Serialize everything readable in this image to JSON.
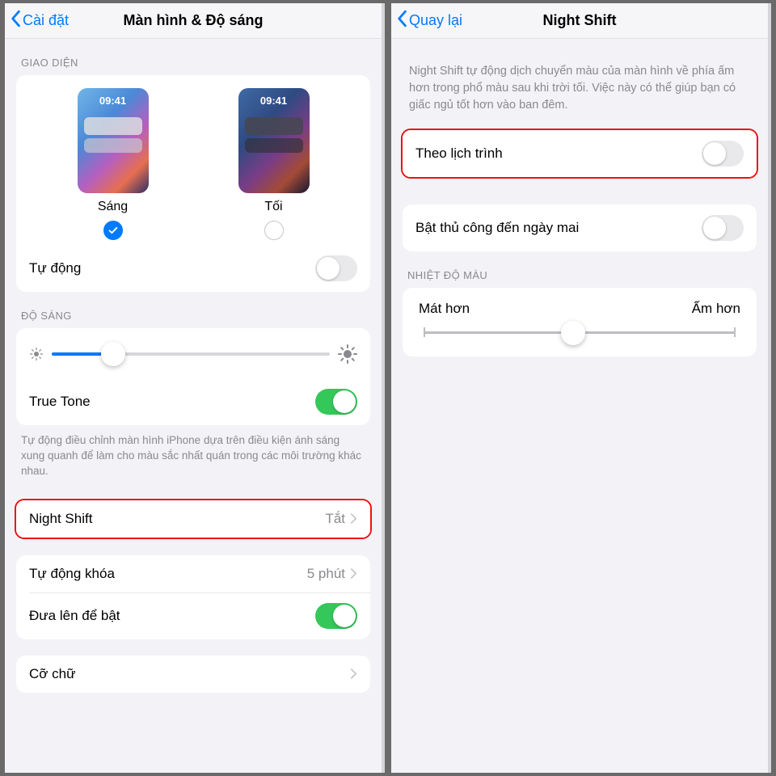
{
  "left": {
    "nav_back": "Cài đặt",
    "nav_title": "Màn hình & Độ sáng",
    "section_appearance": "GIAO DIỆN",
    "preview_time": "09:41",
    "light_label": "Sáng",
    "dark_label": "Tối",
    "automatic_label": "Tự động",
    "automatic_on": false,
    "section_brightness": "ĐỘ SÁNG",
    "true_tone_label": "True Tone",
    "true_tone_on": true,
    "true_tone_desc": "Tự động điều chỉnh màn hình iPhone dựa trên điều kiện ánh sáng xung quanh để làm cho màu sắc nhất quán trong các môi trường khác nhau.",
    "night_shift_label": "Night Shift",
    "night_shift_value": "Tắt",
    "auto_lock_label": "Tự động khóa",
    "auto_lock_value": "5 phút",
    "raise_to_wake_label": "Đưa lên để bật",
    "raise_to_wake_on": true,
    "text_size_label": "Cỡ chữ"
  },
  "right": {
    "nav_back": "Quay lại",
    "nav_title": "Night Shift",
    "intro": "Night Shift tự động dịch chuyển màu của màn hình về phía ấm hơn trong phổ màu sau khi trời tối. Việc này có thể giúp bạn có giấc ngủ tốt hơn vào ban đêm.",
    "scheduled_label": "Theo lịch trình",
    "scheduled_on": false,
    "manual_label": "Bật thủ công đến ngày mai",
    "manual_on": false,
    "section_temp": "NHIỆT ĐỘ MÀU",
    "cooler_label": "Mát hơn",
    "warmer_label": "Ấm hơn"
  }
}
